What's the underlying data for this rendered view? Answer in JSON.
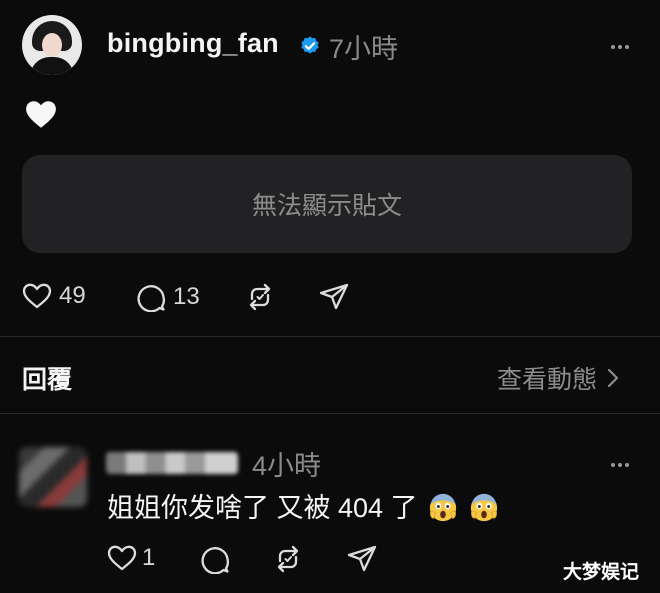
{
  "post": {
    "username": "bingbing_fan",
    "time": "7小時",
    "unavailable_text": "無法顯示貼文",
    "likes": "49",
    "comments": "13"
  },
  "replies_header": {
    "label": "回覆",
    "view_activity": "查看動態"
  },
  "comment": {
    "time": "4小時",
    "text": "姐姐你发啥了 又被 404 了",
    "likes": "1"
  },
  "watermark": "大梦娱记",
  "colors": {
    "background": "#0b0b0c",
    "verified": "#1d9bf0",
    "muted": "#8a8a8a"
  },
  "icons": [
    "heart-icon",
    "comment-icon",
    "repost-icon",
    "share-icon",
    "more-icon",
    "verified-badge-icon",
    "chevron-right-icon",
    "scream-emoji"
  ]
}
